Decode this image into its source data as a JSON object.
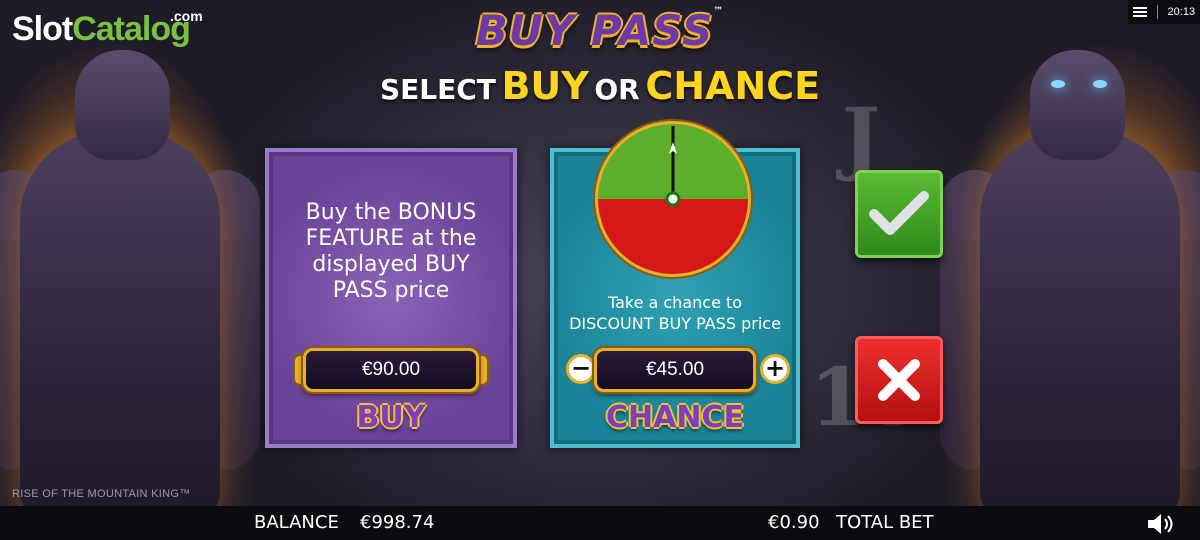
{
  "watermark": {
    "slot": "Slot",
    "catalog": "Catalog",
    "domain": ".com"
  },
  "status": {
    "time": "20:13",
    "menu_icon": "hamburger-menu-icon"
  },
  "header": {
    "title": "BUY PASS",
    "trademark": "™",
    "prompt_select": "SELECT",
    "prompt_buy": "BUY",
    "prompt_or": "OR",
    "prompt_chance": "CHANCE"
  },
  "buy_panel": {
    "description": "Buy the BONUS FEATURE at the displayed BUY PASS price",
    "price": "€90.00",
    "action_label": "BUY"
  },
  "chance_panel": {
    "description": "Take a chance to DISCOUNT BUY PASS price",
    "price": "€45.00",
    "decrease_label": "−",
    "increase_label": "+",
    "action_label": "CHANCE",
    "wheel": {
      "win_color": "#5cae2b",
      "lose_color": "#d41818"
    }
  },
  "side_buttons": {
    "confirm_icon": "checkmark-icon",
    "cancel_icon": "close-x-icon"
  },
  "game_name": "RISE OF THE MOUNTAIN KING™",
  "footer": {
    "balance_label": "BALANCE",
    "balance_value": "€998.74",
    "bet_value": "€0.90",
    "bet_label": "TOTAL BET",
    "sound_icon": "speaker-icon"
  }
}
